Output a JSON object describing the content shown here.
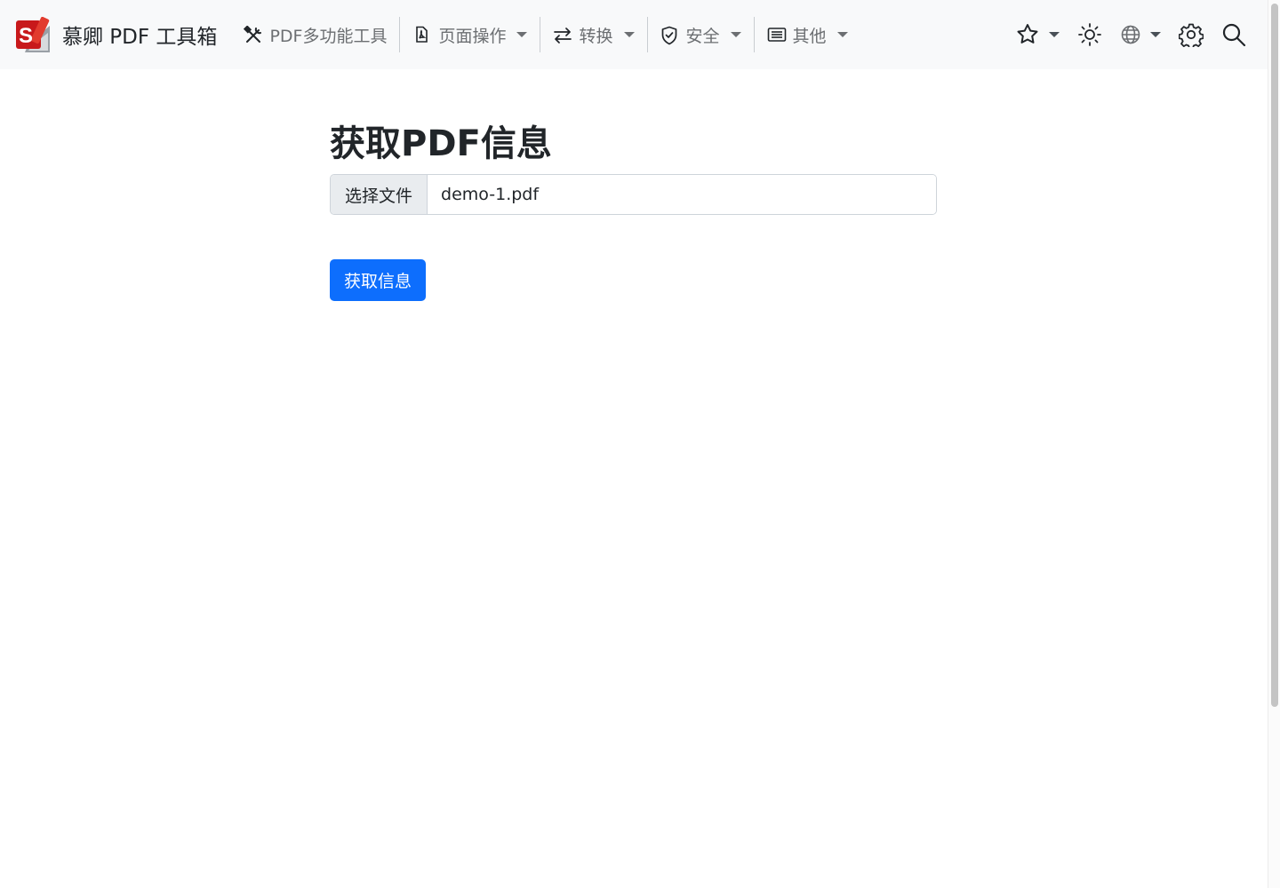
{
  "brand": {
    "title": "慕卿 PDF 工具箱",
    "logo_letter": "S"
  },
  "nav": {
    "items": [
      {
        "label": "PDF多功能工具",
        "icon": "tools-icon",
        "dropdown": false
      },
      {
        "label": "页面操作",
        "icon": "file-pdf-icon",
        "dropdown": true
      },
      {
        "label": "转换",
        "icon": "arrow-left-right-icon",
        "dropdown": true
      },
      {
        "label": "安全",
        "icon": "shield-check-icon",
        "dropdown": true
      },
      {
        "label": "其他",
        "icon": "list-card-icon",
        "dropdown": true
      }
    ],
    "right_icons": [
      "star-icon",
      "sun-icon",
      "globe-icon",
      "gear-icon",
      "search-icon"
    ]
  },
  "main": {
    "title": "获取PDF信息",
    "file_button_label": "选择文件",
    "file_name": "demo-1.pdf",
    "submit_label": "获取信息"
  },
  "colors": {
    "primary": "#0d6efd",
    "navbar_bg": "#f8f9fa",
    "logo_red": "#c8191b"
  }
}
